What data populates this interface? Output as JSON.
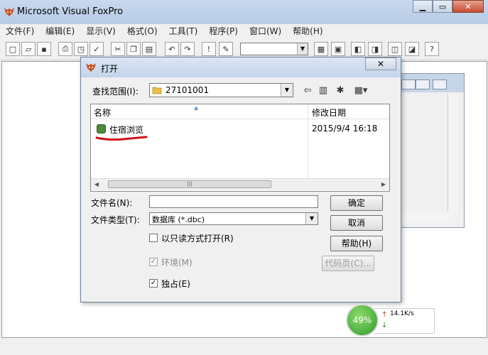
{
  "app": {
    "title": "Microsoft Visual FoxPro"
  },
  "menu": [
    "文件(F)",
    "编辑(E)",
    "显示(V)",
    "格式(O)",
    "工具(T)",
    "程序(P)",
    "窗口(W)",
    "帮助(H)"
  ],
  "toolbar": {
    "combo_value": ""
  },
  "dialog": {
    "title": "打开",
    "close_label": "✕",
    "lookin_label": "查找范围(I):",
    "lookin_value": "27101001",
    "columns": {
      "name": "名称",
      "modified": "修改日期"
    },
    "files": [
      {
        "name": "住宿浏览",
        "modified": "2015/9/4 16:18"
      }
    ],
    "filename_label": "文件名(N):",
    "filename_value": "",
    "filetype_label": "文件类型(T):",
    "filetype_value": "数据库 (*.dbc)",
    "readonly_label": "以只读方式打开(R)",
    "readonly_checked": false,
    "env_label": "环境(M)",
    "env_checked": true,
    "exclusive_label": "独占(E)",
    "exclusive_checked": true,
    "buttons": {
      "ok": "确定",
      "cancel": "取消",
      "help": "帮助(H)",
      "codepage": "代码页(C)..."
    }
  },
  "network": {
    "percent": "49%",
    "speed": "14.1K/s"
  }
}
